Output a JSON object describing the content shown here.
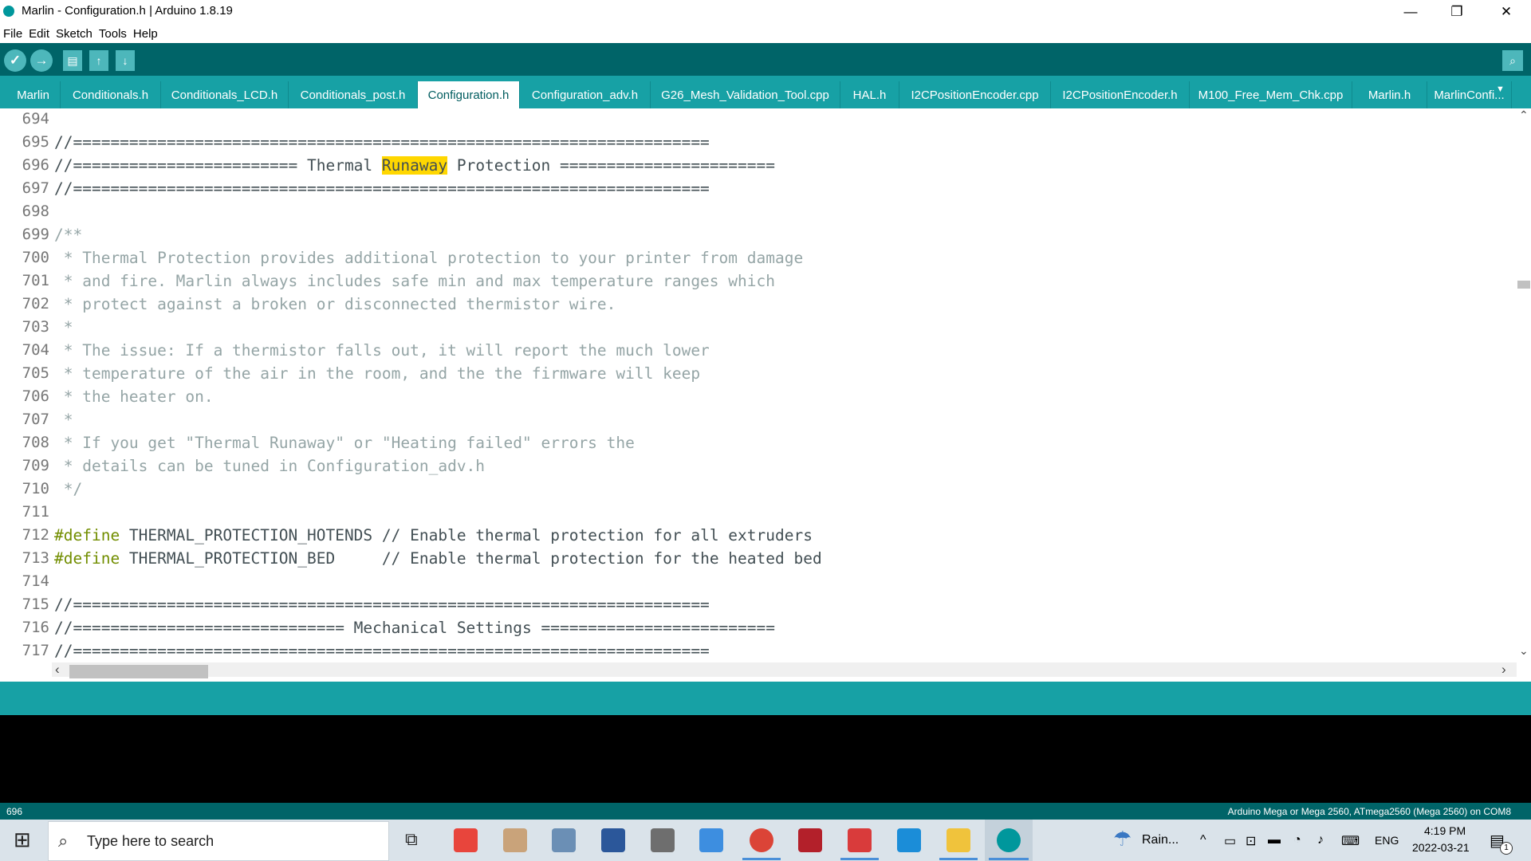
{
  "window": {
    "title": "Marlin - Configuration.h | Arduino 1.8.19",
    "minimize_glyph": "—",
    "maximize_glyph": "❐",
    "close_glyph": "✕"
  },
  "menu": [
    "File",
    "Edit",
    "Sketch",
    "Tools",
    "Help"
  ],
  "toolbar": {
    "verify_glyph": "✓",
    "upload_glyph": "→",
    "new_glyph": "▤",
    "open_glyph": "↑",
    "save_glyph": "↓",
    "serial_glyph": "⌕"
  },
  "tabs": [
    {
      "label": "Marlin"
    },
    {
      "label": "Conditionals.h"
    },
    {
      "label": "Conditionals_LCD.h"
    },
    {
      "label": "Conditionals_post.h"
    },
    {
      "label": "Configuration.h",
      "active": true
    },
    {
      "label": "Configuration_adv.h"
    },
    {
      "label": "G26_Mesh_Validation_Tool.cpp"
    },
    {
      "label": "HAL.h"
    },
    {
      "label": "I2CPositionEncoder.cpp"
    },
    {
      "label": "I2CPositionEncoder.h"
    },
    {
      "label": "M100_Free_Mem_Chk.cpp"
    },
    {
      "label": "Marlin.h"
    },
    {
      "label": "MarlinConfi..."
    }
  ],
  "tab_menu_glyph": "▼",
  "editor": {
    "lines": [
      {
        "n": "694",
        "text": ""
      },
      {
        "n": "695",
        "text": "//===================================================================="
      },
      {
        "n": "696",
        "pre": "//======================== Thermal ",
        "hl": "Runaway",
        "post": " Protection ======================="
      },
      {
        "n": "697",
        "text": "//===================================================================="
      },
      {
        "n": "698",
        "text": ""
      },
      {
        "n": "699",
        "text": "/**"
      },
      {
        "n": "700",
        "text": " * Thermal Protection provides additional protection to your printer from damage"
      },
      {
        "n": "701",
        "text": " * and fire. Marlin always includes safe min and max temperature ranges which"
      },
      {
        "n": "702",
        "text": " * protect against a broken or disconnected thermistor wire."
      },
      {
        "n": "703",
        "text": " *"
      },
      {
        "n": "704",
        "text": " * The issue: If a thermistor falls out, it will report the much lower"
      },
      {
        "n": "705",
        "text": " * temperature of the air in the room, and the the firmware will keep"
      },
      {
        "n": "706",
        "text": " * the heater on."
      },
      {
        "n": "707",
        "text": " *"
      },
      {
        "n": "708",
        "text": " * If you get \"Thermal Runaway\" or \"Heating failed\" errors the"
      },
      {
        "n": "709",
        "text": " * details can be tuned in Configuration_adv.h"
      },
      {
        "n": "710",
        "text": " */"
      },
      {
        "n": "711",
        "text": ""
      },
      {
        "n": "712",
        "kw": "#define",
        "name": " THERMAL_PROTECTION_HOTENDS ",
        "comment": "// Enable thermal protection for all extruders"
      },
      {
        "n": "713",
        "kw": "#define",
        "name": " THERMAL_PROTECTION_BED     ",
        "comment": "// Enable thermal protection for the heated bed"
      },
      {
        "n": "714",
        "text": ""
      },
      {
        "n": "715",
        "text": "//===================================================================="
      },
      {
        "n": "716",
        "text": "//============================= Mechanical Settings ========================="
      },
      {
        "n": "717",
        "text": "//===================================================================="
      }
    ]
  },
  "scroll": {
    "up_glyph": "⌃",
    "down_glyph": "⌄",
    "left_glyph": "‹",
    "right_glyph": "›"
  },
  "status": {
    "line_number": "696",
    "board": "Arduino Mega or Mega 2560, ATmega2560 (Mega 2560) on COM8"
  },
  "taskbar": {
    "start_glyph": "⊞",
    "search_glyph": "⌕",
    "search_placeholder": "Type here to search",
    "task_view_glyph": "⧉",
    "weather": "Rain...",
    "weather_glyph": "☂",
    "tray_chevron": "^",
    "tray_glyphs": [
      "▭",
      "⊡",
      "▬",
      "◔",
      "♪",
      "⌨"
    ],
    "language": "ENG",
    "time": "4:19 PM",
    "date": "2022-03-21",
    "notifications_glyph": "▤",
    "notifications_count": "1",
    "apps": [
      {
        "name": "screen-recorder",
        "color": "#e8453c"
      },
      {
        "name": "paint",
        "color": "#c9a37a"
      },
      {
        "name": "photos",
        "color": "#6b8fb5"
      },
      {
        "name": "word",
        "color": "#2b579a"
      },
      {
        "name": "calculator",
        "color": "#6e6e6e"
      },
      {
        "name": "remote-desktop",
        "color": "#3d8ee0"
      },
      {
        "name": "chrome",
        "color": "#db4437"
      },
      {
        "name": "autodesk",
        "color": "#b3202a"
      },
      {
        "name": "settings-tool",
        "color": "#d93b3b"
      },
      {
        "name": "ccleaner",
        "color": "#1b8dd8"
      },
      {
        "name": "file-explorer",
        "color": "#f0c33c"
      },
      {
        "name": "arduino",
        "color": "#00979c"
      }
    ]
  }
}
